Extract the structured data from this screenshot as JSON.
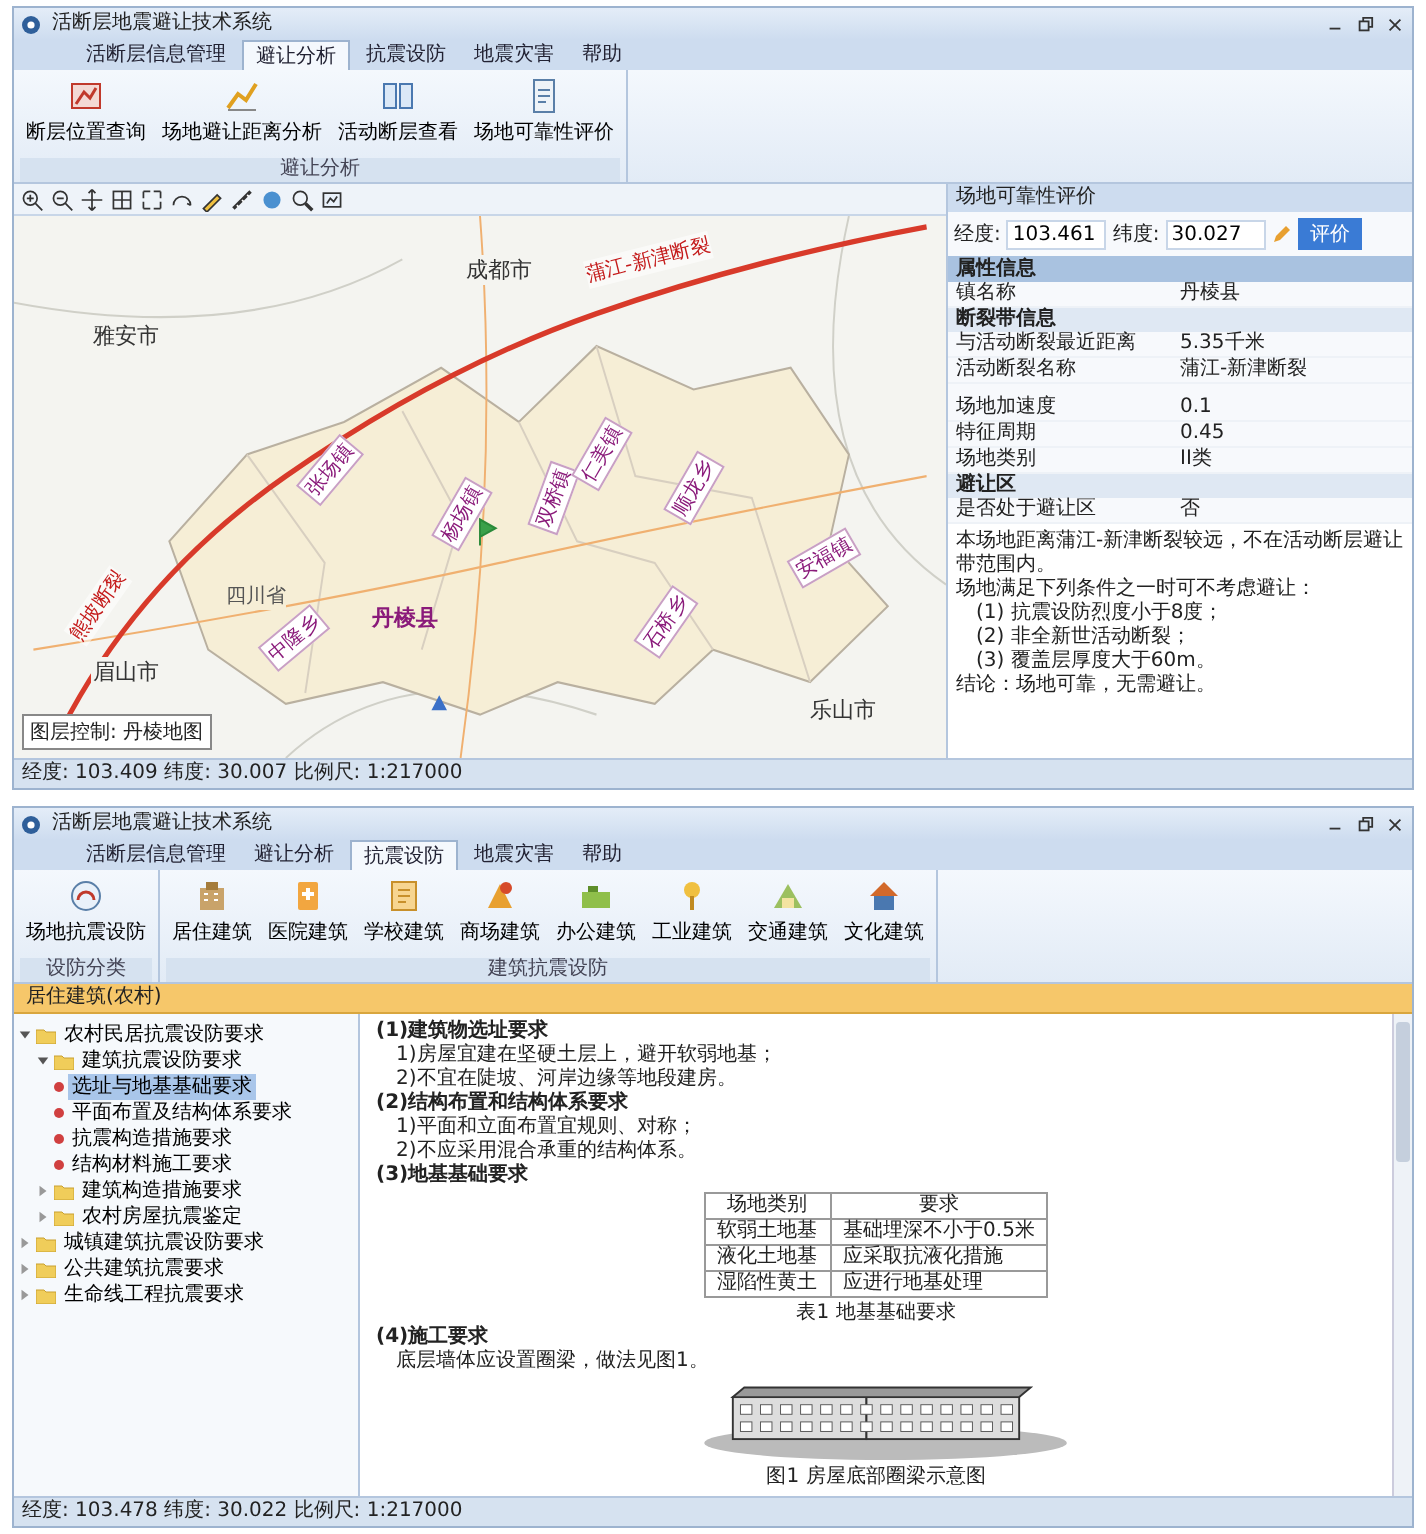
{
  "map_window": {
    "title": "活断层地震避让技术系统",
    "tabs": [
      {
        "label": "活断层信息管理",
        "selected": false
      },
      {
        "label": "避让分析",
        "selected": true
      },
      {
        "label": "抗震设防",
        "selected": false
      },
      {
        "label": "地震灾害",
        "selected": false
      },
      {
        "label": "帮助",
        "selected": false
      }
    ],
    "ribbon_groups": [
      {
        "label": "避让分析",
        "buttons": [
          "断层位置查询",
          "场地避让距离分析",
          "活动断层查看",
          "场地可靠性评价"
        ]
      }
    ],
    "map": {
      "cities": [
        "成都市",
        "雅安市",
        "眉山市",
        "乐山市"
      ],
      "county": "丹棱县",
      "province": "四川省",
      "faults": [
        "蒲江-新津断裂",
        "熊坡断裂"
      ],
      "towns": [
        "张场镇",
        "杨场镇",
        "双桥镇",
        "仁美镇",
        "顺龙乡",
        "石桥乡",
        "中隆乡",
        "安福镇"
      ],
      "layer_label": "图层控制: 丹棱地图"
    },
    "panel": {
      "title": "场地可靠性评价",
      "longitude": {
        "label": "经度:",
        "value": "103.461"
      },
      "latitude": {
        "label": "纬度:",
        "value": "30.027"
      },
      "button": "评价",
      "section": "属性信息",
      "rows": [
        {
          "kind": "pair",
          "name": "镇名称",
          "value": "丹棱县"
        },
        {
          "kind": "group",
          "name": "断裂带信息"
        },
        {
          "kind": "pair",
          "name": "与活动断裂最近距离",
          "value": "5.35千米"
        },
        {
          "kind": "pair",
          "name": "活动断裂名称",
          "value": "蒲江-新津断裂"
        },
        {
          "kind": "spacer"
        },
        {
          "kind": "pair",
          "name": "场地加速度",
          "value": "0.1"
        },
        {
          "kind": "pair",
          "name": "特征周期",
          "value": "0.45"
        },
        {
          "kind": "pair",
          "name": "场地类别",
          "value": "II类"
        },
        {
          "kind": "group",
          "name": "避让区"
        },
        {
          "kind": "pair",
          "name": "是否处于避让区",
          "value": "否"
        }
      ],
      "description": "本场地距离蒲江-新津断裂较远，不在活动断层避让带范围内。",
      "conditions_intro": "场地满足下列条件之一时可不考虑避让：",
      "conditions": [
        "(1) 抗震设防烈度小于8度；",
        "(2) 非全新世活动断裂；",
        "(3) 覆盖层厚度大于60m。"
      ],
      "conclusion": "结论：场地可靠，无需避让。"
    },
    "status_bar": "经度: 103.409  纬度: 30.007  比例尺: 1:217000"
  },
  "document_window": {
    "title": "活断层地震避让技术系统",
    "tabs": [
      {
        "label": "活断层信息管理",
        "selected": false
      },
      {
        "label": "避让分析",
        "selected": false
      },
      {
        "label": "抗震设防",
        "selected": true
      },
      {
        "label": "地震灾害",
        "selected": false
      },
      {
        "label": "帮助",
        "selected": false
      }
    ],
    "ribbon_groups": [
      {
        "label": "设防分类",
        "buttons": [
          "场地抗震设防"
        ]
      },
      {
        "label": "建筑抗震设防",
        "buttons": [
          "居住建筑",
          "医院建筑",
          "学校建筑",
          "商场建筑",
          "办公建筑",
          "工业建筑",
          "交通建筑",
          "文化建筑"
        ]
      }
    ],
    "bar_label": "居住建筑(农村)",
    "tree": [
      {
        "kind": "folder",
        "label": "农村民居抗震设防要求",
        "expanded": true,
        "selected": false,
        "children": [
          {
            "kind": "folder",
            "label": "建筑抗震设防要求",
            "expanded": true,
            "selected": false,
            "children": [
              {
                "kind": "leaf",
                "label": "选址与地基基础要求",
                "selected": true
              },
              {
                "kind": "leaf",
                "label": "平面布置及结构体系要求",
                "selected": false
              },
              {
                "kind": "leaf",
                "label": "抗震构造措施要求",
                "selected": false
              },
              {
                "kind": "leaf",
                "label": "结构材料施工要求",
                "selected": false
              }
            ]
          },
          {
            "kind": "folder",
            "label": "建筑构造措施要求",
            "expanded": false,
            "selected": false
          },
          {
            "kind": "folder",
            "label": "农村房屋抗震鉴定",
            "expanded": false,
            "selected": false
          }
        ]
      },
      {
        "kind": "folder",
        "label": "城镇建筑抗震设防要求",
        "expanded": false,
        "selected": false
      },
      {
        "kind": "folder",
        "label": "公共建筑抗震要求",
        "expanded": false,
        "selected": false
      },
      {
        "kind": "folder",
        "label": "生命线工程抗震要求",
        "expanded": false,
        "selected": false
      }
    ],
    "document": [
      {
        "kind": "heading",
        "text": "(1)建筑物选址要求"
      },
      {
        "kind": "line",
        "text": "1)房屋宜建在坚硬土层上，避开软弱地基；"
      },
      {
        "kind": "line",
        "text": "2)不宜在陡坡、河岸边缘等地段建房。"
      },
      {
        "kind": "heading",
        "text": "(2)结构布置和结构体系要求"
      },
      {
        "kind": "line",
        "text": "1)平面和立面布置宜规则、对称；"
      },
      {
        "kind": "line",
        "text": "2)不应采用混合承重的结构体系。"
      },
      {
        "kind": "heading",
        "text": "(3)地基基础要求"
      },
      {
        "kind": "table",
        "columns": [
          "场地类别",
          "要求"
        ],
        "rows": [
          [
            "软弱土地基",
            "基础埋深不小于0.5米"
          ],
          [
            "液化土地基",
            "应采取抗液化措施"
          ],
          [
            "湿陷性黄土",
            "应进行地基处理"
          ]
        ]
      },
      {
        "kind": "caption",
        "text": "表1 地基基础要求"
      },
      {
        "kind": "heading",
        "text": "(4)施工要求"
      },
      {
        "kind": "line",
        "text": "底层墙体应设置圈梁，做法见图1。"
      },
      {
        "kind": "figure"
      },
      {
        "kind": "caption",
        "text": "图1 房屋底部圈梁示意图"
      }
    ],
    "status_bar": "经度: 103.478  纬度: 30.022  比例尺: 1:217000"
  }
}
